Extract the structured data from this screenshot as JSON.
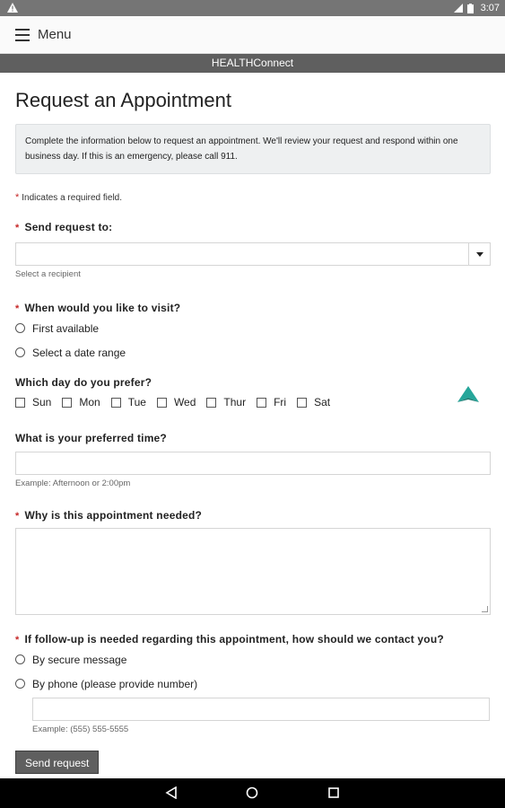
{
  "statusbar": {
    "time": "3:07"
  },
  "appbar": {
    "menu_label": "Menu"
  },
  "brandbar": {
    "title": "HEALTHConnect"
  },
  "page": {
    "title": "Request an Appointment",
    "info": "Complete the information below to request an appointment. We'll review your request and respond within one business day. If this is an emergency, please call 911.",
    "required_note": "Indicates a required field.",
    "required_marker": "*"
  },
  "recipient": {
    "label": "Send request to:",
    "value": "",
    "hint": "Select a recipient"
  },
  "visit": {
    "label": "When would you like to visit?",
    "options": [
      "First available",
      "Select a date range"
    ]
  },
  "days": {
    "label": "Which day do you prefer?",
    "items": [
      "Sun",
      "Mon",
      "Tue",
      "Wed",
      "Thur",
      "Fri",
      "Sat"
    ]
  },
  "time": {
    "label": "What is your preferred time?",
    "value": "",
    "hint": "Example: Afternoon or 2:00pm"
  },
  "reason": {
    "label": "Why is this appointment needed?",
    "value": ""
  },
  "followup": {
    "label": "If follow-up is needed regarding this appointment, how should we contact you?",
    "options": [
      "By secure message",
      "By phone (please provide number)"
    ],
    "phone_hint": "Example: (555) 555-5555"
  },
  "submit": {
    "label": "Send request"
  },
  "colors": {
    "accent": "#26a69a",
    "required": "#c62828",
    "header": "#5f5f5f"
  }
}
